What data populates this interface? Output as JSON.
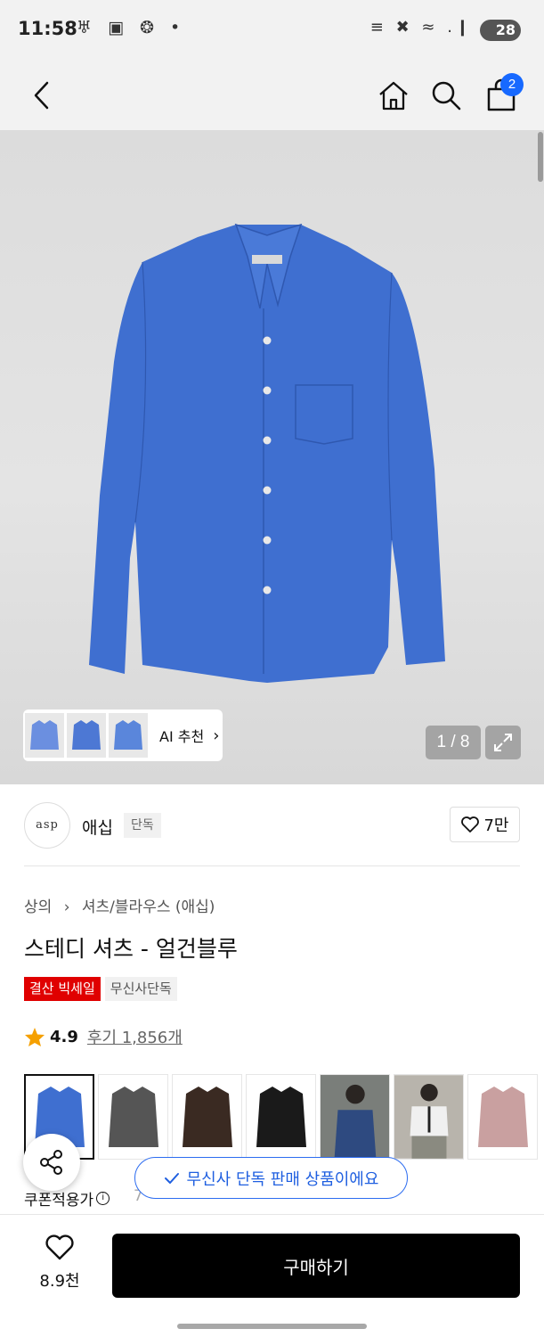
{
  "status_bar": {
    "time": "11:58",
    "icons_left": "♅ ▣ ❂ •",
    "icons_right": "≡ ✖ ≈ .❙",
    "battery": "28"
  },
  "nav": {
    "back_icon": "chevron-left-icon",
    "home_icon": "home-icon",
    "search_icon": "search-icon",
    "cart_icon": "shopping-bag-icon",
    "cart_count": "2"
  },
  "gallery": {
    "ai_label": "AI 추천",
    "ai_chevron": "›",
    "counter": "1 / 8",
    "expand_icon": "expand-icon",
    "shirt_color": "#3f6fd0"
  },
  "brand": {
    "logo_text": "asp",
    "name": "애십",
    "tag": "단독",
    "likes": "7만"
  },
  "product": {
    "breadcrumb": [
      "상의",
      "›",
      "셔츠/블라우스 (애십)"
    ],
    "title": "스테디 셔츠 - 얼건블루",
    "badge_sale": "결산 빅세일",
    "badge_exclusive": "무신사단독",
    "rating_score": "4.9",
    "reviews": "후기 1,856개",
    "coupon_label": "쿠폰적용가",
    "coupon_price": "7"
  },
  "swatches": [
    {
      "name": "blue",
      "color": "#3f6fd0"
    },
    {
      "name": "charcoal",
      "color": "#555555"
    },
    {
      "name": "brown",
      "color": "#3a2a22"
    },
    {
      "name": "black",
      "color": "#1a1a1a"
    },
    {
      "name": "model-blue",
      "color": "#2e4a80"
    },
    {
      "name": "model-white",
      "color": "#e8e8e8"
    },
    {
      "name": "pink",
      "color": "#c9a0a0"
    }
  ],
  "toast": {
    "text": "무신사 단독 판매 상품이에요"
  },
  "bottom": {
    "wish_count": "8.9천",
    "buy_label": "구매하기"
  },
  "colors": {
    "accent_blue": "#1769ff",
    "sale_red": "#e00000",
    "buy_black": "#000000"
  }
}
